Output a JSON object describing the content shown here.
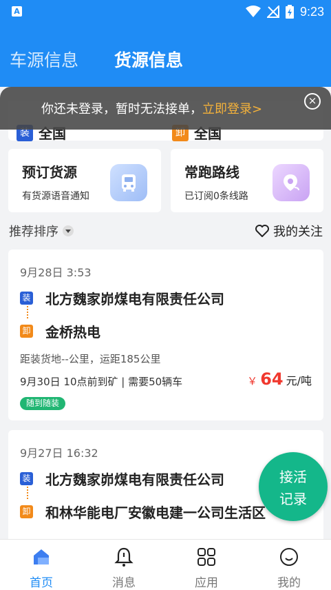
{
  "status_bar": {
    "time": "9:23"
  },
  "header": {
    "tabs": [
      {
        "label": "车源信息",
        "active": false
      },
      {
        "label": "货源信息",
        "active": true
      }
    ]
  },
  "login_banner": {
    "text": "你还未登录，暂时无法接单，",
    "link": "立即登录>"
  },
  "filter": {
    "load_tag": "装",
    "load_value": "全国",
    "unload_tag": "卸",
    "unload_value": "全国"
  },
  "features": [
    {
      "title": "预订货源",
      "subtitle": "有货源语音通知",
      "icon": "truck-icon"
    },
    {
      "title": "常跑路线",
      "subtitle": "已订阅0条线路",
      "icon": "route-pin-icon"
    }
  ],
  "sort": {
    "label": "推荐排序",
    "follow_label": "我的关注"
  },
  "orders": [
    {
      "time": "9月28日 3:53",
      "load_tag": "装",
      "from": "北方魏家峁煤电有限责任公司",
      "unload_tag": "卸",
      "to": "金桥热电",
      "distance": "距装货地--公里，运距185公里",
      "info": "9月30日 10点前到矿 | 需要50辆车",
      "price_symbol": "￥",
      "price": "64",
      "price_unit": "元/吨",
      "badge": "随到随装"
    },
    {
      "time": "9月27日 16:32",
      "load_tag": "装",
      "from": "北方魏家峁煤电有限责任公司",
      "unload_tag": "卸",
      "to": "和林华能电厂安徽电建一公司生活区"
    }
  ],
  "fab": {
    "line1": "接活",
    "line2": "记录"
  },
  "bottom_nav": [
    {
      "label": "首页",
      "icon": "home-icon",
      "active": true
    },
    {
      "label": "消息",
      "icon": "bell-icon",
      "active": false
    },
    {
      "label": "应用",
      "icon": "apps-grid-icon",
      "active": false
    },
    {
      "label": "我的",
      "icon": "profile-icon",
      "active": false
    }
  ],
  "colors": {
    "primary": "#1f8cf5",
    "price": "#f0382e",
    "load_tag": "#2a5fd6",
    "unload_tag": "#f28a1a",
    "badge": "#21b673",
    "fab": "#14b78a"
  }
}
